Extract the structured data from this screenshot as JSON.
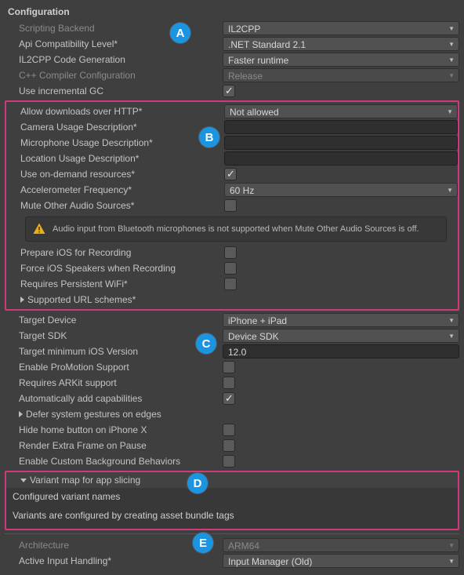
{
  "header": "Configuration",
  "badges": {
    "A": "A",
    "B": "B",
    "C": "C",
    "D": "D",
    "E": "E"
  },
  "section_a": {
    "scripting_backend": {
      "label": "Scripting Backend",
      "value": "IL2CPP"
    },
    "api_compat": {
      "label": "Api Compatibility Level*",
      "value": ".NET Standard 2.1"
    },
    "il2cpp_codegen": {
      "label": "IL2CPP Code Generation",
      "value": "Faster runtime"
    },
    "cpp_compiler": {
      "label": "C++ Compiler Configuration",
      "value": "Release"
    },
    "incremental_gc": {
      "label": "Use incremental GC",
      "checked": true
    }
  },
  "section_b": {
    "http": {
      "label": "Allow downloads over HTTP*",
      "value": "Not allowed"
    },
    "camera": {
      "label": "Camera Usage Description*",
      "value": ""
    },
    "mic": {
      "label": "Microphone Usage Description*",
      "value": ""
    },
    "location": {
      "label": "Location Usage Description*",
      "value": ""
    },
    "on_demand": {
      "label": "Use on-demand resources*",
      "checked": true
    },
    "accel": {
      "label": "Accelerometer Frequency*",
      "value": "60 Hz"
    },
    "mute_other": {
      "label": "Mute Other Audio Sources*",
      "checked": false
    },
    "bt_msg": "Audio input from Bluetooth microphones is not supported when Mute Other Audio Sources is off.",
    "prepare_rec": {
      "label": "Prepare iOS for Recording",
      "checked": false
    },
    "force_speakers": {
      "label": "Force iOS Speakers when Recording",
      "checked": false
    },
    "persist_wifi": {
      "label": "Requires Persistent WiFi*",
      "checked": false
    },
    "url_schemes": {
      "label": "Supported URL schemes*"
    }
  },
  "section_c": {
    "target_device": {
      "label": "Target Device",
      "value": "iPhone + iPad"
    },
    "target_sdk": {
      "label": "Target SDK",
      "value": "Device SDK"
    },
    "min_ios": {
      "label": "Target minimum iOS Version",
      "value": "12.0"
    },
    "promotion": {
      "label": "Enable ProMotion Support",
      "checked": false
    },
    "arkit": {
      "label": "Requires ARKit support",
      "checked": false
    },
    "auto_caps": {
      "label": "Automatically add capabilities",
      "checked": true
    },
    "defer_gestures": {
      "label": "Defer system gestures on edges"
    },
    "hide_home": {
      "label": "Hide home button on iPhone X",
      "checked": false
    },
    "extra_frame": {
      "label": "Render Extra Frame on Pause",
      "checked": false
    },
    "custom_bg": {
      "label": "Enable Custom Background Behaviors",
      "checked": false
    }
  },
  "section_d": {
    "title": "Variant map for app slicing",
    "subtitle": "Configured variant names",
    "msg": "Variants are configured by creating asset bundle tags"
  },
  "section_e": {
    "arch": {
      "label": "Architecture",
      "value": "ARM64"
    },
    "input": {
      "label": "Active Input Handling*",
      "value": "Input Manager (Old)"
    }
  }
}
